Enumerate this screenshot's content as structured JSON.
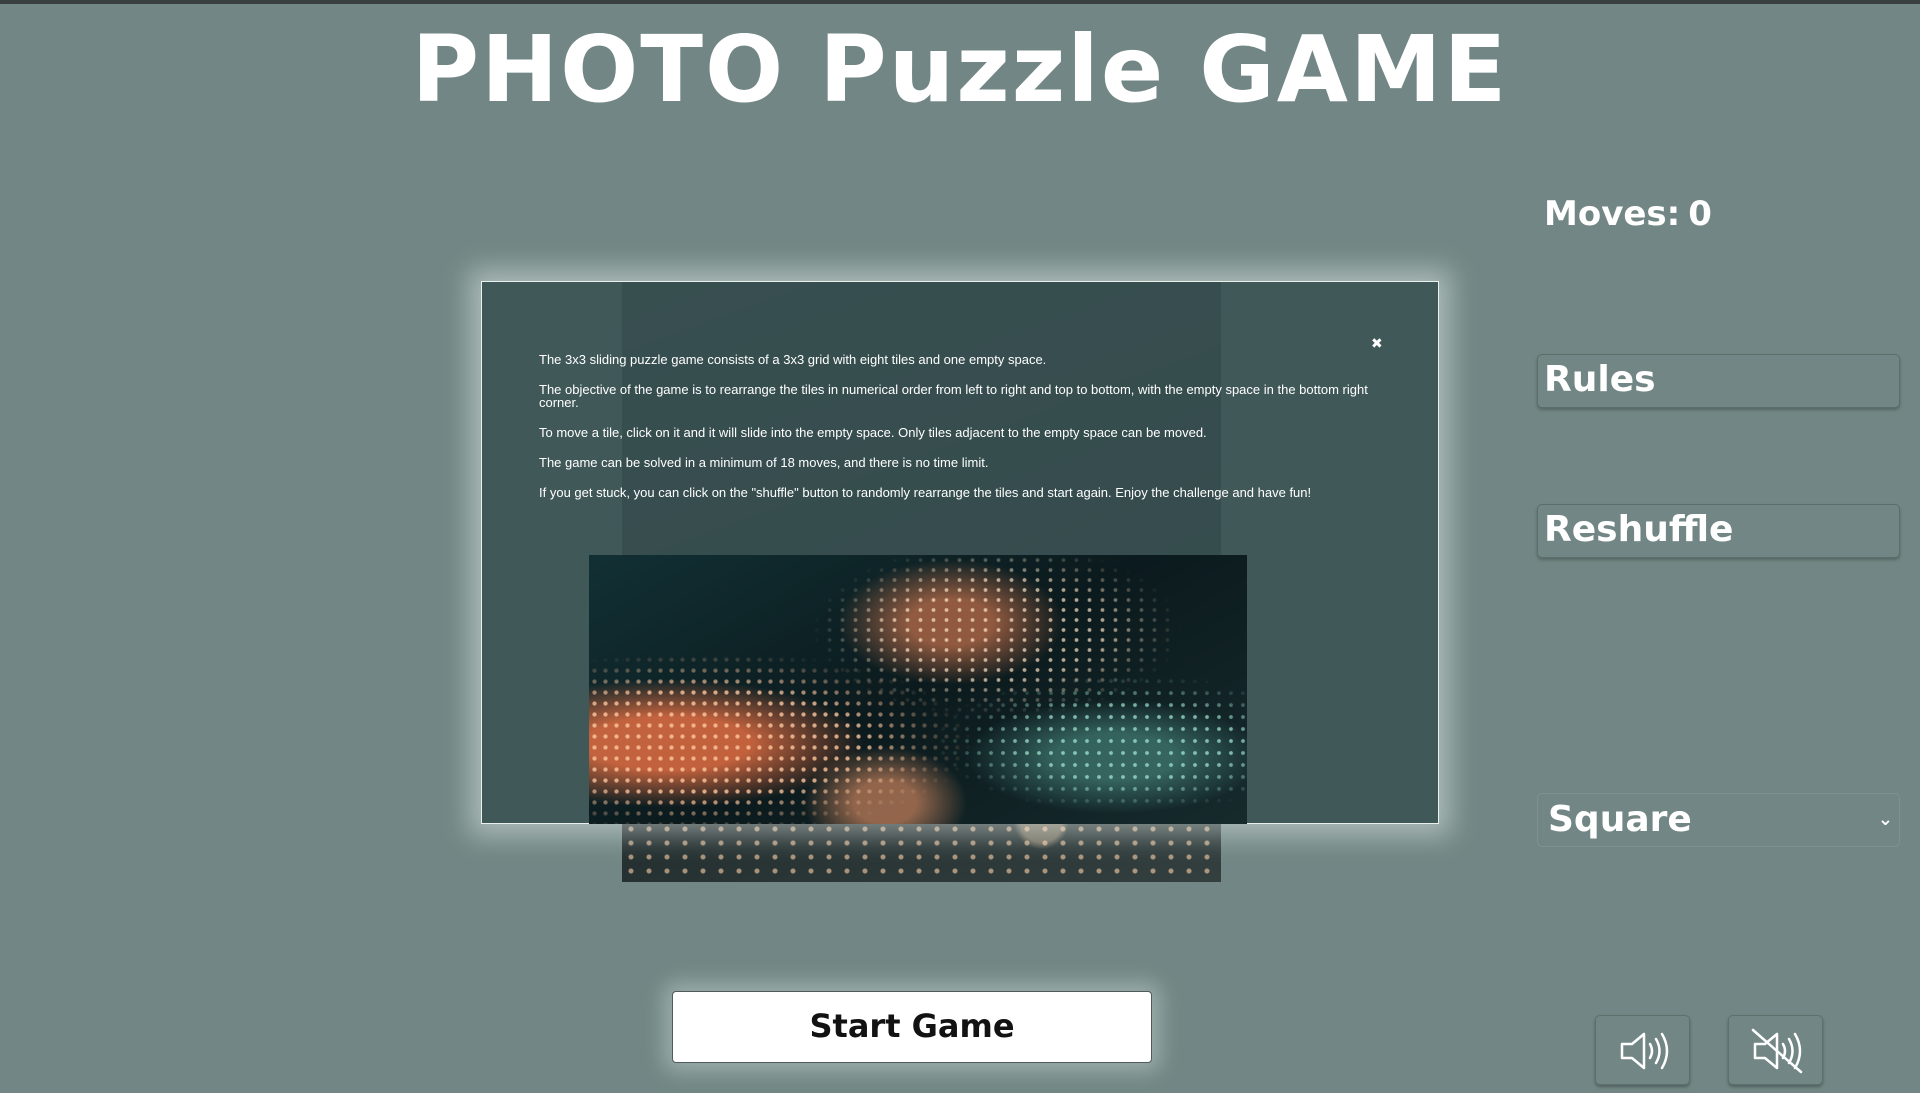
{
  "header": {
    "title": "PHOTO Puzzle GAME"
  },
  "stats": {
    "moves_label": "Moves:",
    "moves_value": "0"
  },
  "sidebar": {
    "rules_label": "Rules",
    "reshuffle_label": "Reshuffle",
    "shape_select": {
      "selected": "Square"
    }
  },
  "modal": {
    "close_symbol": "✖",
    "rules": [
      "The 3x3 sliding puzzle game consists of a 3x3 grid with eight tiles and one empty space.",
      "The objective of the game is to rearrange the tiles in numerical order from left to right and top to bottom, with the empty space in the bottom right corner.",
      "To move a tile, click on it and it will slide into the empty space. Only tiles adjacent to the empty space can be moved.",
      "The game can be solved in a minimum of 18 moves, and there is no time limit.",
      "If you get stuck, you can click on the \"shuffle\" button to randomly rearrange the tiles and start again. Enjoy the challenge and have fun!"
    ]
  },
  "footer": {
    "start_label": "Start Game",
    "sound_on_icon": "speaker-on-icon",
    "sound_off_icon": "speaker-mute-icon"
  },
  "colors": {
    "background": "#728785",
    "modal_bg": "#3a5253",
    "text": "#ffffff",
    "start_button_bg": "#ffffff"
  }
}
